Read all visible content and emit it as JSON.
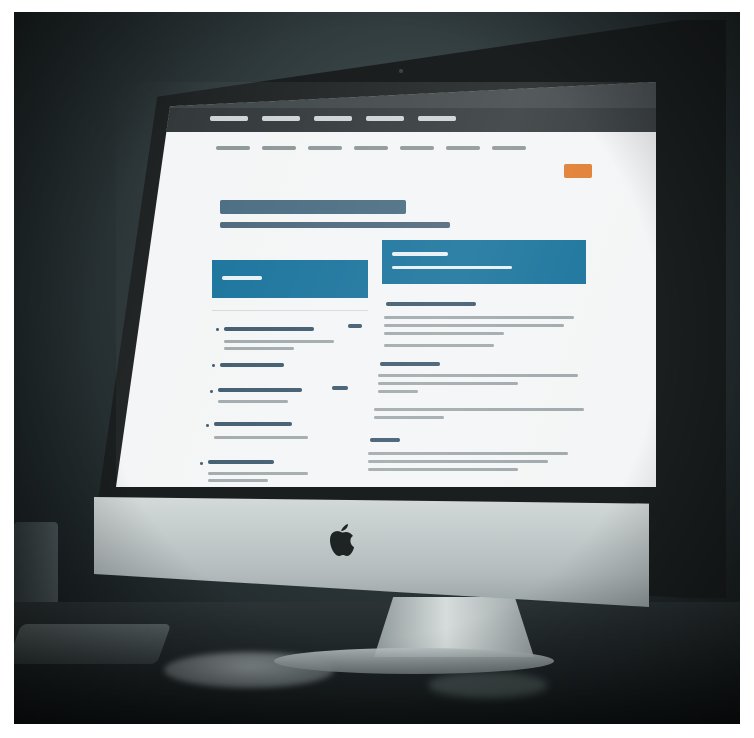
{
  "scene": {
    "subject": "desktop-monitor",
    "brand_logo_icon": "apple-logo-icon",
    "colors": {
      "screen_accent": "#14709a",
      "button_accent": "#e07a2c",
      "chin": "#c4cbcc",
      "background": "#2c3638"
    }
  }
}
